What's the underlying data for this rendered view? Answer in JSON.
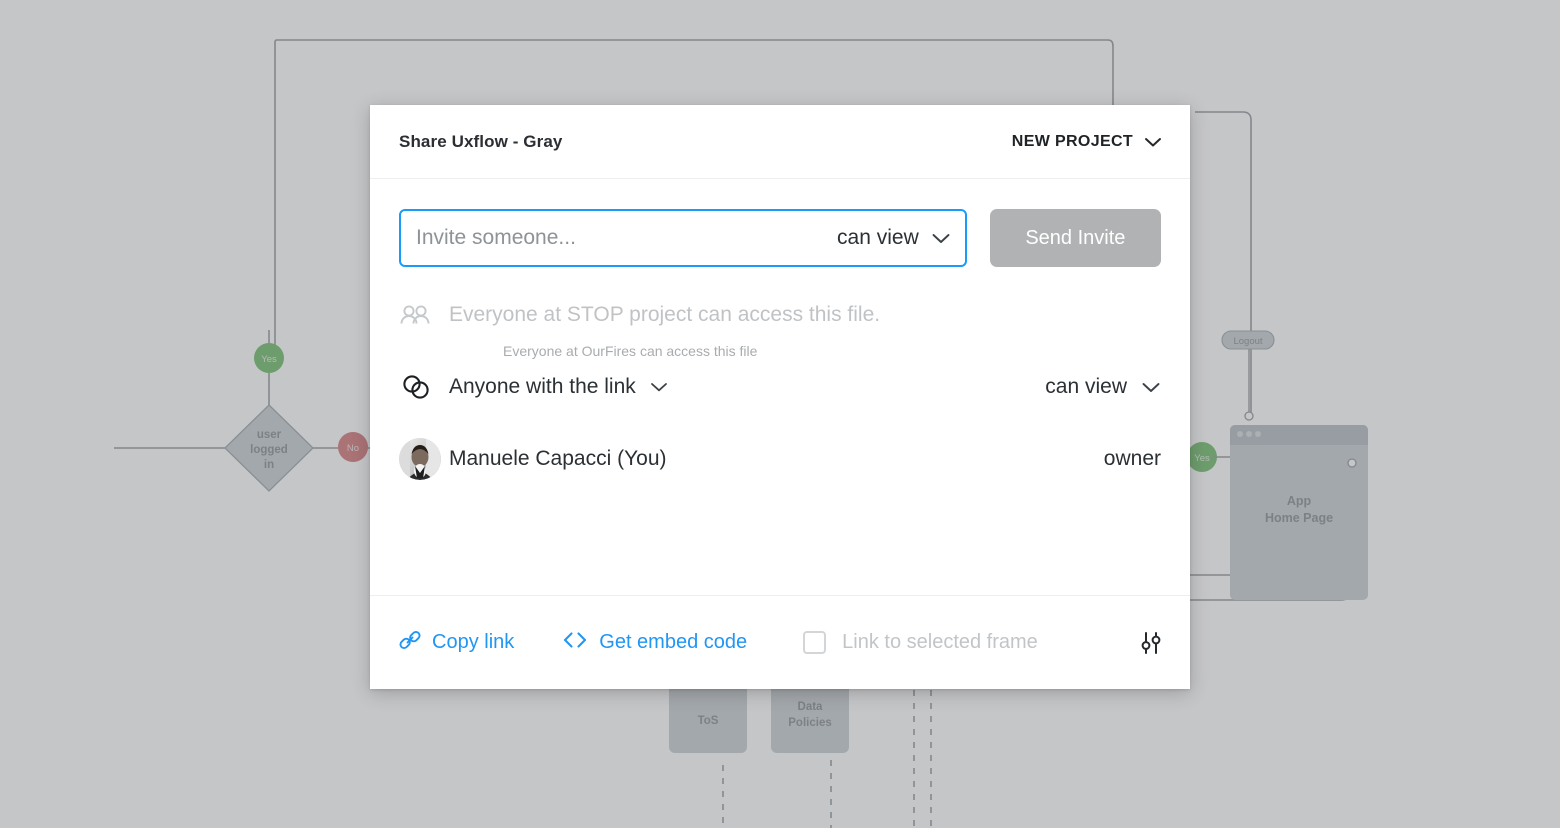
{
  "modal": {
    "title": "Share Uxflow - Gray",
    "project_switch": {
      "label": "NEW PROJECT",
      "icon": "chevron-down-icon"
    },
    "invite": {
      "placeholder": "Invite someone...",
      "value": "",
      "permission": "can view",
      "permission_icon": "chevron-down-icon",
      "send_button": "Send Invite",
      "accent_color": "#1a9bfc",
      "send_button_color": "#b0b2b4"
    },
    "hint": "Everyone at OurFires can access this file",
    "access_rows": [
      {
        "icon": "people-icon",
        "label": "Everyone at STOP project can access this file.",
        "right": "",
        "muted": true
      },
      {
        "icon": "link-circles-icon",
        "label": "Anyone with the link",
        "label_icon": "chevron-down-icon",
        "right": "can view",
        "right_icon": "chevron-down-icon",
        "muted": false
      },
      {
        "icon": "avatar",
        "label": "Manuele Capacci (You)",
        "right": "owner",
        "muted": false
      }
    ],
    "footer": {
      "copy_link": {
        "label": "Copy link",
        "icon": "chain-link-icon"
      },
      "embed_code": {
        "label": "Get embed code",
        "icon": "code-brackets-icon"
      },
      "frame_checkbox": {
        "label": "Link to selected frame",
        "checked": false
      },
      "settings": {
        "icon": "sliders-icon"
      },
      "link_color": "#2196f3"
    }
  },
  "canvas": {
    "nodes": [
      {
        "name": "decision-user-logged-in",
        "label": "user logged in",
        "type": "diamond"
      },
      {
        "name": "badge-yes-top",
        "label": "Yes",
        "type": "badge",
        "color": "#3fa535"
      },
      {
        "name": "badge-no",
        "label": "No",
        "type": "badge",
        "color": "#c4484a"
      },
      {
        "name": "badge-yes-right",
        "label": "Yes",
        "type": "badge",
        "color": "#3fa535"
      },
      {
        "name": "pill-logout",
        "label": "Logout",
        "type": "pill"
      },
      {
        "name": "frame-app-home-page",
        "label": "App Home Page",
        "type": "browser-frame"
      },
      {
        "name": "card-tos",
        "label": "ToS",
        "type": "card"
      },
      {
        "name": "card-data-policies",
        "label": "Data Policies",
        "type": "card"
      }
    ],
    "colors": {
      "background": "#ffffff",
      "overlay": "#b1b3b5",
      "shape_fill": "#b4bcc2",
      "stroke": "#6f7479"
    }
  }
}
